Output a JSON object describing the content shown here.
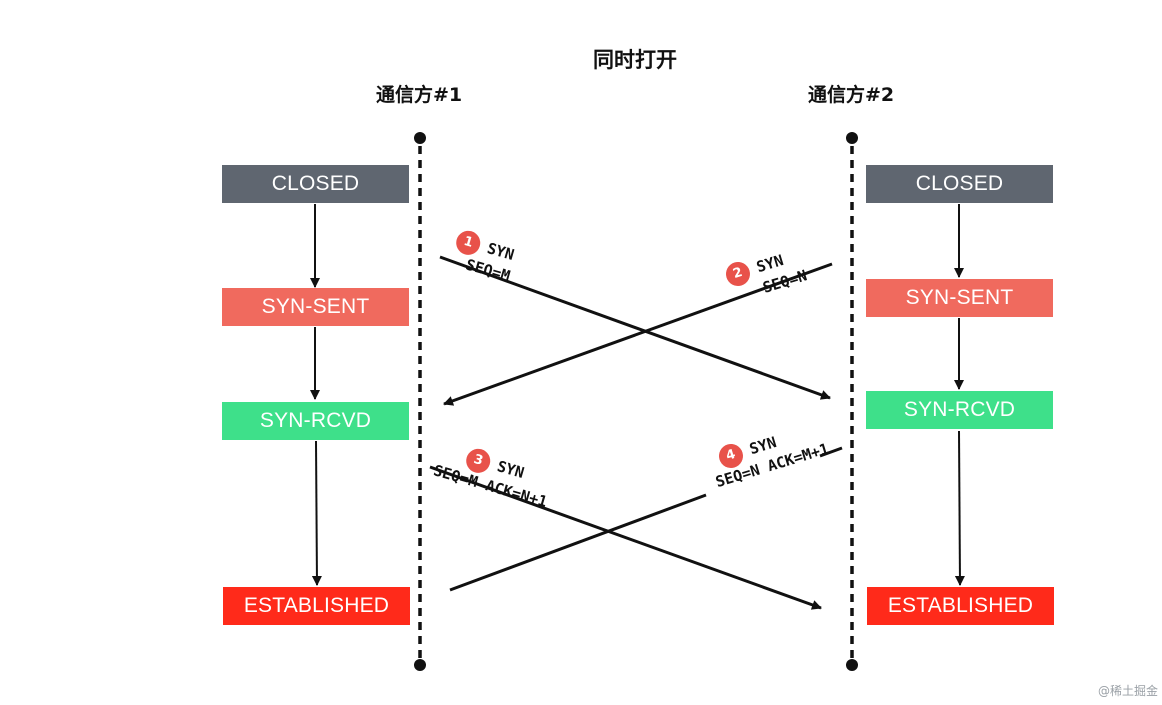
{
  "title": "同时打开",
  "parties": {
    "left": "通信方#1",
    "right": "通信方#2"
  },
  "states": {
    "left": [
      "CLOSED",
      "SYN-SENT",
      "SYN-RCVD",
      "ESTABLISHED"
    ],
    "right": [
      "CLOSED",
      "SYN-SENT",
      "SYN-RCVD",
      "ESTABLISHED"
    ]
  },
  "colors": {
    "closed": "#5f6670",
    "syn_sent": "#f06a5e",
    "syn_rcvd": "#3ee08a",
    "established": "#ff2a1a",
    "badge": "#e8524a"
  },
  "messages": [
    {
      "num": "1",
      "line1": "SYN",
      "line2": "SEQ=M"
    },
    {
      "num": "2",
      "line1": "SYN",
      "line2": "SEQ=N"
    },
    {
      "num": "3",
      "line1": "SYN",
      "line2": "SEQ=M ACK=N+1"
    },
    {
      "num": "4",
      "line1": "SYN",
      "line2": "SEQ=N ACK=M+1"
    }
  ],
  "watermark": "@稀土掘金"
}
